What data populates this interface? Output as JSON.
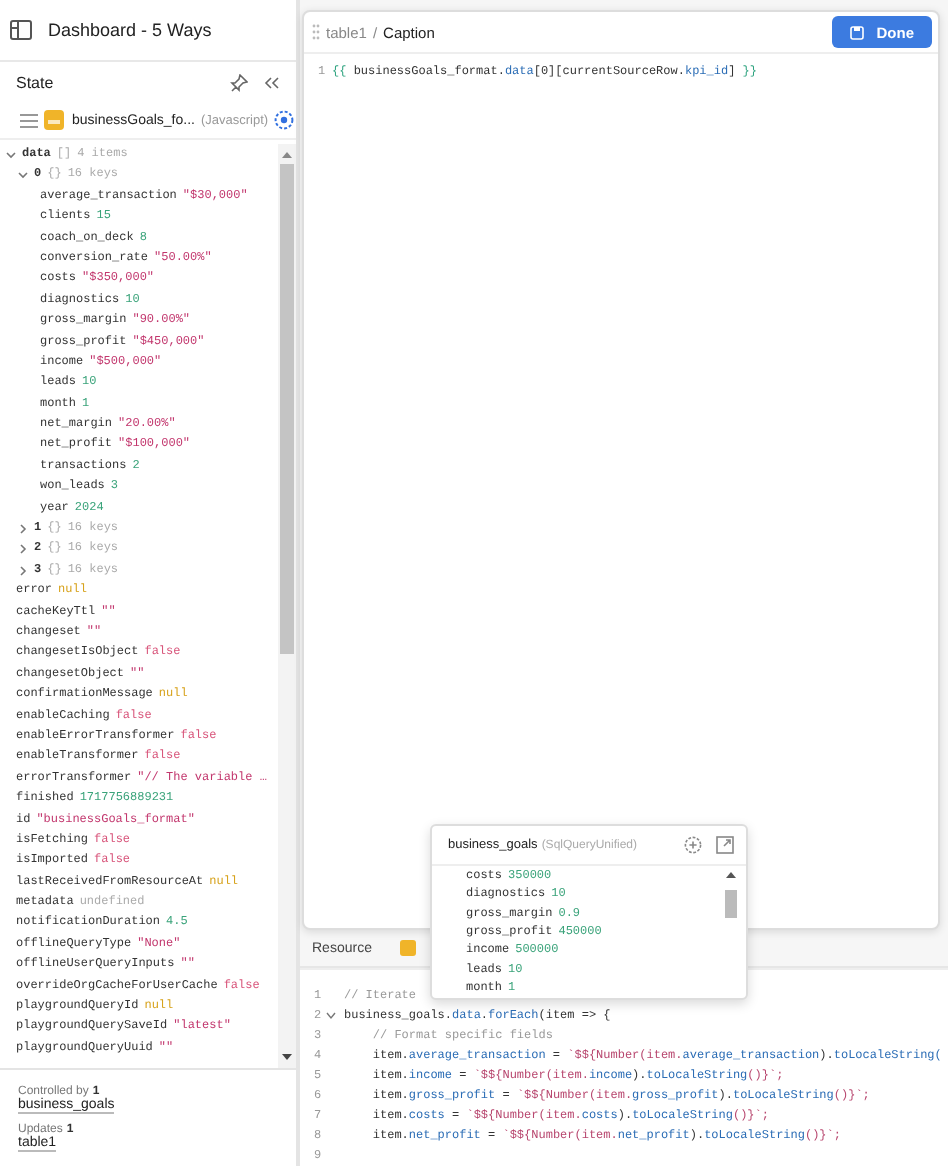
{
  "app": {
    "title": "Dashboard - 5 Ways"
  },
  "state_panel": {
    "title": "State",
    "query": {
      "name": "businessGoals_fo...",
      "type": "(Javascript)"
    },
    "tree": [
      {
        "key": "data",
        "brackets": "[]",
        "summary": "4 items",
        "expanded": true,
        "children": [
          {
            "key": "0",
            "brackets": "{}",
            "summary": "16 keys",
            "expanded": true,
            "children": [
              {
                "key": "average_transaction",
                "value": "\"$30,000\"",
                "kind": "string"
              },
              {
                "key": "clients",
                "value": "15",
                "kind": "number"
              },
              {
                "key": "coach_on_deck",
                "value": "8",
                "kind": "number"
              },
              {
                "key": "conversion_rate",
                "value": "\"50.00%\"",
                "kind": "string"
              },
              {
                "key": "costs",
                "value": "\"$350,000\"",
                "kind": "string"
              },
              {
                "key": "diagnostics",
                "value": "10",
                "kind": "number"
              },
              {
                "key": "gross_margin",
                "value": "\"90.00%\"",
                "kind": "string"
              },
              {
                "key": "gross_profit",
                "value": "\"$450,000\"",
                "kind": "string"
              },
              {
                "key": "income",
                "value": "\"$500,000\"",
                "kind": "string"
              },
              {
                "key": "leads",
                "value": "10",
                "kind": "number"
              },
              {
                "key": "month",
                "value": "1",
                "kind": "number"
              },
              {
                "key": "net_margin",
                "value": "\"20.00%\"",
                "kind": "string"
              },
              {
                "key": "net_profit",
                "value": "\"$100,000\"",
                "kind": "string"
              },
              {
                "key": "transactions",
                "value": "2",
                "kind": "number"
              },
              {
                "key": "won_leads",
                "value": "3",
                "kind": "number"
              },
              {
                "key": "year",
                "value": "2024",
                "kind": "number"
              }
            ]
          },
          {
            "key": "1",
            "brackets": "{}",
            "summary": "16 keys",
            "expanded": false
          },
          {
            "key": "2",
            "brackets": "{}",
            "summary": "16 keys",
            "expanded": false
          },
          {
            "key": "3",
            "brackets": "{}",
            "summary": "16 keys",
            "expanded": false
          }
        ]
      },
      {
        "key": "error",
        "value": "null",
        "kind": "null"
      },
      {
        "key": "cacheKeyTtl",
        "value": "\"\"",
        "kind": "string"
      },
      {
        "key": "changeset",
        "value": "\"\"",
        "kind": "string"
      },
      {
        "key": "changesetIsObject",
        "value": "false",
        "kind": "boolean"
      },
      {
        "key": "changesetObject",
        "value": "\"\"",
        "kind": "string"
      },
      {
        "key": "confirmationMessage",
        "value": "null",
        "kind": "null"
      },
      {
        "key": "enableCaching",
        "value": "false",
        "kind": "boolean"
      },
      {
        "key": "enableErrorTransformer",
        "value": "false",
        "kind": "boolean"
      },
      {
        "key": "enableTransformer",
        "value": "false",
        "kind": "boolean"
      },
      {
        "key": "errorTransformer",
        "value": "\"// The variable …",
        "kind": "string"
      },
      {
        "key": "finished",
        "value": "1717756889231",
        "kind": "number"
      },
      {
        "key": "id",
        "value": "\"businessGoals_format\"",
        "kind": "string"
      },
      {
        "key": "isFetching",
        "value": "false",
        "kind": "boolean"
      },
      {
        "key": "isImported",
        "value": "false",
        "kind": "boolean"
      },
      {
        "key": "lastReceivedFromResourceAt",
        "value": "null",
        "kind": "null"
      },
      {
        "key": "metadata",
        "value": "undefined",
        "kind": "undefined"
      },
      {
        "key": "notificationDuration",
        "value": "4.5",
        "kind": "number"
      },
      {
        "key": "offlineQueryType",
        "value": "\"None\"",
        "kind": "string"
      },
      {
        "key": "offlineUserQueryInputs",
        "value": "\"\"",
        "kind": "string"
      },
      {
        "key": "overrideOrgCacheForUserCache",
        "value": "false",
        "kind": "boolean"
      },
      {
        "key": "playgroundQueryId",
        "value": "null",
        "kind": "null"
      },
      {
        "key": "playgroundQuerySaveId",
        "value": "\"latest\"",
        "kind": "string"
      },
      {
        "key": "playgroundQueryUuid",
        "value": "\"\"",
        "kind": "string"
      }
    ],
    "controlled_by": {
      "label": "Controlled by",
      "count": "1",
      "link": "business_goals"
    },
    "updates": {
      "label": "Updates",
      "count": "1",
      "link": "table1"
    }
  },
  "caption_editor": {
    "breadcrumb": "table1",
    "separator": "/",
    "title": "Caption",
    "done_button": "Done",
    "lines": [
      {
        "number": "1",
        "tokens": [
          {
            "text": "{{ ",
            "kind": "brace"
          },
          {
            "text": "businessGoals_format.",
            "kind": "plain"
          },
          {
            "text": "data",
            "kind": "prop"
          },
          {
            "text": "[0][currentSourceRow.",
            "kind": "plain"
          },
          {
            "text": "kpi_id",
            "kind": "prop"
          },
          {
            "text": "] ",
            "kind": "plain"
          },
          {
            "text": "}}",
            "kind": "brace"
          }
        ]
      }
    ]
  },
  "resource_tab": {
    "label": "Resource"
  },
  "code_editor": {
    "lines": [
      {
        "number": "1",
        "tokens": [
          {
            "text": "// Iterate",
            "kind": "comment"
          }
        ]
      },
      {
        "number": "2",
        "fold": true,
        "tokens": [
          {
            "text": "business_goals.",
            "kind": "plain"
          },
          {
            "text": "data",
            "kind": "prop"
          },
          {
            "text": ".",
            "kind": "plain"
          },
          {
            "text": "forEach",
            "kind": "prop"
          },
          {
            "text": "(item => {",
            "kind": "plain"
          }
        ]
      },
      {
        "number": "3",
        "tokens": [
          {
            "text": "    // Format specific fields",
            "kind": "comment"
          }
        ]
      },
      {
        "number": "4",
        "tokens": [
          {
            "text": "    item.",
            "kind": "plain"
          },
          {
            "text": "average_transaction",
            "kind": "prop"
          },
          {
            "text": " = ",
            "kind": "plain"
          },
          {
            "text": "`$${Number(item.",
            "kind": "string"
          },
          {
            "text": "average_transaction",
            "kind": "prop"
          },
          {
            "text": ").",
            "kind": "plain"
          },
          {
            "text": "toLocaleString(",
            "kind": "prop"
          }
        ]
      },
      {
        "number": "5",
        "tokens": [
          {
            "text": "    item.",
            "kind": "plain"
          },
          {
            "text": "income",
            "kind": "prop"
          },
          {
            "text": " = ",
            "kind": "plain"
          },
          {
            "text": "`$${Number(item.",
            "kind": "string"
          },
          {
            "text": "income",
            "kind": "prop"
          },
          {
            "text": ").",
            "kind": "plain"
          },
          {
            "text": "toLocaleString",
            "kind": "prop"
          },
          {
            "text": "()}`;",
            "kind": "string"
          }
        ]
      },
      {
        "number": "6",
        "tokens": [
          {
            "text": "    item.",
            "kind": "plain"
          },
          {
            "text": "gross_profit",
            "kind": "prop"
          },
          {
            "text": " = ",
            "kind": "plain"
          },
          {
            "text": "`$${Number(item.",
            "kind": "string"
          },
          {
            "text": "gross_profit",
            "kind": "prop"
          },
          {
            "text": ").",
            "kind": "plain"
          },
          {
            "text": "toLocaleString",
            "kind": "prop"
          },
          {
            "text": "()}`;",
            "kind": "string"
          }
        ]
      },
      {
        "number": "7",
        "tokens": [
          {
            "text": "    item.",
            "kind": "plain"
          },
          {
            "text": "costs",
            "kind": "prop"
          },
          {
            "text": " = ",
            "kind": "plain"
          },
          {
            "text": "`$${Number(item.",
            "kind": "string"
          },
          {
            "text": "costs",
            "kind": "prop"
          },
          {
            "text": ").",
            "kind": "plain"
          },
          {
            "text": "toLocaleString",
            "kind": "prop"
          },
          {
            "text": "()}`;",
            "kind": "string"
          }
        ]
      },
      {
        "number": "8",
        "tokens": [
          {
            "text": "    item.",
            "kind": "plain"
          },
          {
            "text": "net_profit",
            "kind": "prop"
          },
          {
            "text": " = ",
            "kind": "plain"
          },
          {
            "text": "`$${Number(item.",
            "kind": "string"
          },
          {
            "text": "net_profit",
            "kind": "prop"
          },
          {
            "text": ").",
            "kind": "plain"
          },
          {
            "text": "toLocaleString",
            "kind": "prop"
          },
          {
            "text": "()}`;",
            "kind": "string"
          }
        ]
      },
      {
        "number": "9"
      }
    ]
  },
  "query_popup": {
    "name": "business_goals",
    "type": "(SqlQueryUnified)",
    "rows": [
      {
        "key": "costs",
        "value": "350000"
      },
      {
        "key": "diagnostics",
        "value": "10"
      },
      {
        "key": "gross_margin",
        "value": "0.9"
      },
      {
        "key": "gross_profit",
        "value": "450000"
      },
      {
        "key": "income",
        "value": "500000"
      },
      {
        "key": "leads",
        "value": "10"
      },
      {
        "key": "month",
        "value": "1"
      }
    ]
  }
}
